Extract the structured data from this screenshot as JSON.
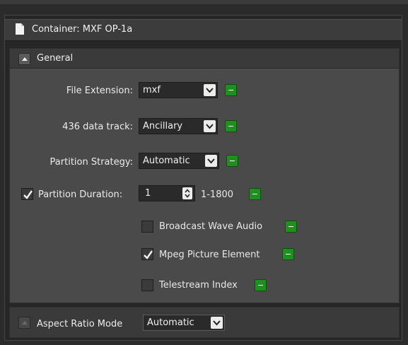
{
  "container": {
    "title": "Container: MXF OP-1a"
  },
  "general": {
    "title": "General",
    "file_extension": {
      "label": "File Extension:",
      "value": "mxf"
    },
    "data_track_436": {
      "label": "436 data track:",
      "value": "Ancillary"
    },
    "partition_strategy": {
      "label": "Partition Strategy:",
      "value": "Automatic"
    },
    "partition_duration": {
      "label": "Partition Duration:",
      "checked": true,
      "value": "1",
      "range": "1-1800"
    },
    "broadcast_wave_audio": {
      "label": "Broadcast Wave Audio",
      "checked": false
    },
    "mpeg_picture_element": {
      "label": "Mpeg Picture Element",
      "checked": true
    },
    "telestream_index": {
      "label": "Telestream Index",
      "checked": false
    }
  },
  "aspect_ratio": {
    "label": "Aspect Ratio Mode",
    "value": "Automatic"
  },
  "colors": {
    "accent_green": "#1f8f1f",
    "panel_bg": "#4a4a4a",
    "header_bg": "#3a3a3a"
  }
}
